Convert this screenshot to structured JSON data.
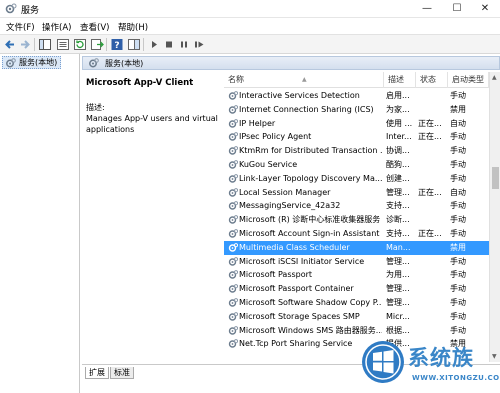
{
  "window": {
    "title": "服务",
    "minimize": "—",
    "maximize": "☐",
    "close": "✕"
  },
  "menu": [
    "文件(F)",
    "操作(A)",
    "查看(V)",
    "帮助(H)"
  ],
  "tree": {
    "root_label": "服务(本地)"
  },
  "pane_header": "服务(本地)",
  "detail": {
    "service_name": "Microsoft App-V Client",
    "caption": "描述:",
    "description": "Manages App-V users and virtual applications"
  },
  "table": {
    "headers": {
      "name": "名称",
      "desc": "描述",
      "status": "状态",
      "start": "启动类型"
    },
    "rows": [
      {
        "name": "Interactive Services Detection",
        "desc": "启用...",
        "status": "",
        "start": "手动"
      },
      {
        "name": "Internet Connection Sharing (ICS)",
        "desc": "为家...",
        "status": "",
        "start": "禁用"
      },
      {
        "name": "IP Helper",
        "desc": "使用 ...",
        "status": "正在...",
        "start": "自动"
      },
      {
        "name": "IPsec Policy Agent",
        "desc": "Inter...",
        "status": "正在...",
        "start": "手动"
      },
      {
        "name": "KtmRm for Distributed Transaction ...",
        "desc": "协调...",
        "status": "",
        "start": "手动"
      },
      {
        "name": "KuGou Service",
        "desc": "酷狗...",
        "status": "",
        "start": "手动"
      },
      {
        "name": "Link-Layer Topology Discovery Ma...",
        "desc": "创建...",
        "status": "",
        "start": "手动"
      },
      {
        "name": "Local Session Manager",
        "desc": "管理...",
        "status": "正在...",
        "start": "自动"
      },
      {
        "name": "MessagingService_42a32",
        "desc": "支持...",
        "status": "",
        "start": "手动"
      },
      {
        "name": "Microsoft (R) 诊断中心标准收集器服务",
        "desc": "诊断...",
        "status": "",
        "start": "手动"
      },
      {
        "name": "Microsoft Account Sign-in Assistant",
        "desc": "支持...",
        "status": "正在...",
        "start": "手动"
      },
      {
        "name": "Multimedia Class Scheduler",
        "desc": "Man...",
        "status": "",
        "start": "禁用"
      },
      {
        "name": "Microsoft iSCSI Initiator Service",
        "desc": "管理...",
        "status": "",
        "start": "手动"
      },
      {
        "name": "Microsoft Passport",
        "desc": "为用...",
        "status": "",
        "start": "手动"
      },
      {
        "name": "Microsoft Passport Container",
        "desc": "管理...",
        "status": "",
        "start": "手动"
      },
      {
        "name": "Microsoft Software Shadow Copy P...",
        "desc": "管理...",
        "status": "",
        "start": "手动"
      },
      {
        "name": "Microsoft Storage Spaces SMP",
        "desc": "Micr...",
        "status": "",
        "start": "手动"
      },
      {
        "name": "Microsoft Windows SMS 路由器服务...",
        "desc": "根据...",
        "status": "",
        "start": "手动"
      },
      {
        "name": "Net.Tcp Port Sharing Service",
        "desc": "提供...",
        "status": "",
        "start": "禁用"
      }
    ],
    "selected_index": 11
  },
  "tabs": {
    "extended": "扩展",
    "standard": "标准"
  },
  "watermark": {
    "brand": "系统族",
    "url": "WWW.XITONGZU.COM"
  },
  "colors": {
    "selection": "#3399ff",
    "brand": "#3a86c8"
  }
}
